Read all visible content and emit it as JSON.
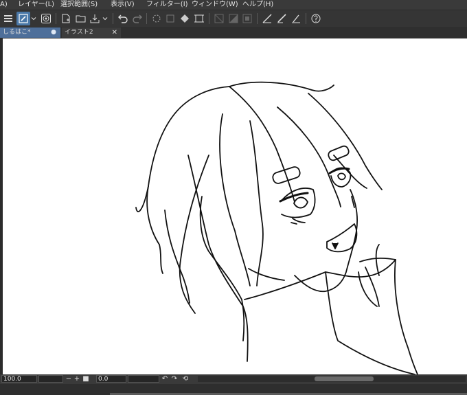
{
  "menu": {
    "items": [
      {
        "label": "A)"
      },
      {
        "label": "レイヤー(L)"
      },
      {
        "label": "選択範囲(S)"
      },
      {
        "label": "表示(V)"
      },
      {
        "label": "フィルター(I)"
      },
      {
        "label": "ウィンドウ(W)"
      },
      {
        "label": "ヘルプ(H)"
      }
    ]
  },
  "toolbar": {
    "icons": [
      "hamburger-menu-icon",
      "pen-tool-icon",
      "dropdown-chevron-icon",
      "swirl-icon",
      "new-file-icon",
      "open-folder-icon",
      "save-icon",
      "dropdown-chevron-icon",
      "undo-icon",
      "redo-icon",
      "loading-spinner-icon",
      "transform-icon",
      "fill-icon",
      "crop-icon",
      "clear-icon",
      "fill-selection-icon",
      "layer-icon",
      "ruler-icon",
      "brush-icon",
      "ruler-settings-icon",
      "help-icon"
    ]
  },
  "tabs": [
    {
      "label": "しるはこ*",
      "active": true
    },
    {
      "label": "イラスト2",
      "active": false
    }
  ],
  "status": {
    "zoom": "100.0",
    "angle": "0.0"
  },
  "colors": {
    "accent": "#4e6f9a",
    "canvas": "#ffffff",
    "chrome": "#353535"
  }
}
